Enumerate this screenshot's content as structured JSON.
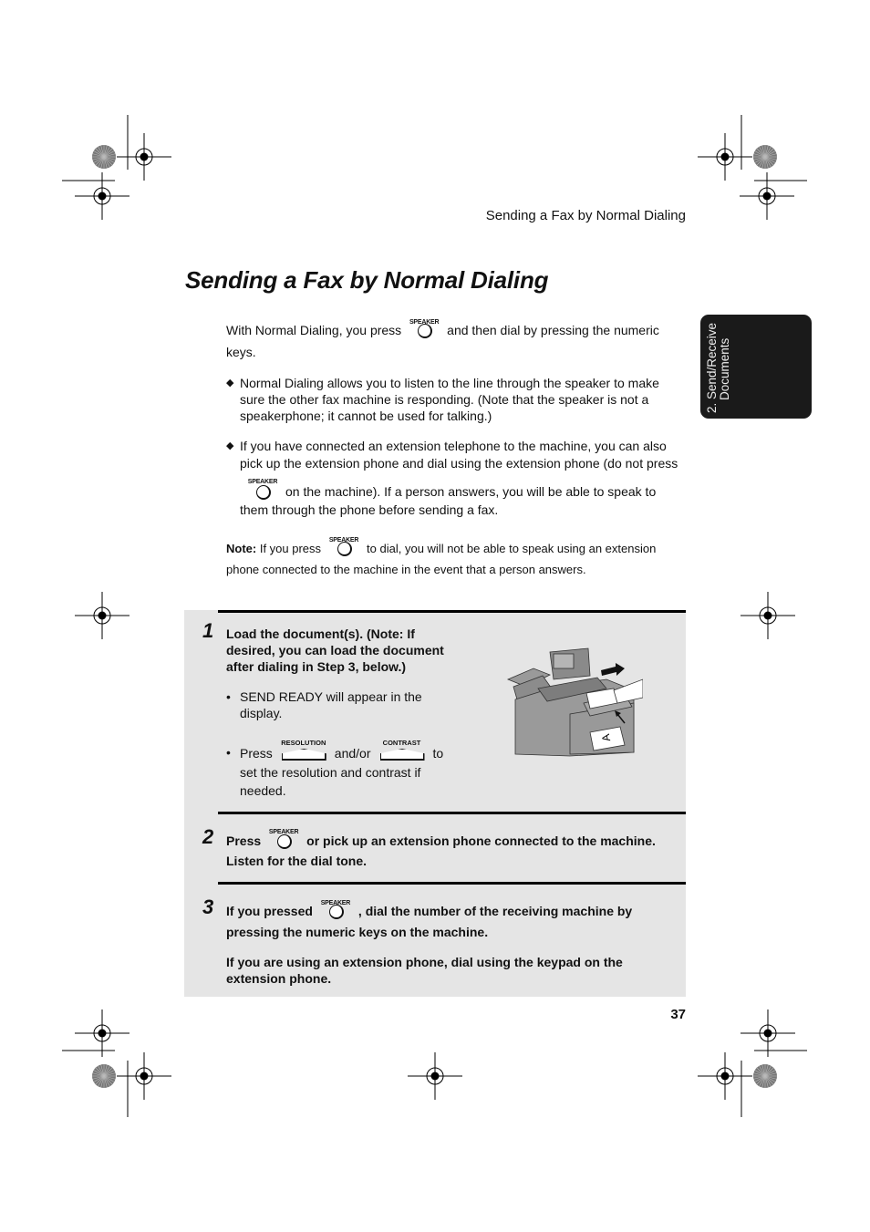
{
  "header": {
    "running_head": "Sending a Fax by Normal Dialing"
  },
  "title": "Sending a Fax by Normal Dialing",
  "side_tab": {
    "line1": "2. Send/Receive",
    "line2": "Documents"
  },
  "keys": {
    "speaker": "SPEAKER",
    "resolution": "RESOLUTION",
    "contrast": "CONTRAST"
  },
  "intro": {
    "before": "With Normal Dialing, you press",
    "after": "and then dial by pressing the numeric keys."
  },
  "bullets": [
    {
      "text": "Normal Dialing allows you to listen to the line through the speaker to make sure the other fax machine is responding. (Note that the speaker is not a speakerphone; it cannot be used for talking.)"
    },
    {
      "before": "If you have connected an extension telephone to the machine, you can also pick up the extension phone and dial using the extension phone (do not press",
      "after": "on the machine). If a person answers, you will be able to speak to them through the phone before sending a fax."
    }
  ],
  "note": {
    "label": "Note:",
    "before": "If you press",
    "after": "to dial, you will not be able to speak using an extension phone connected to the machine in the event that a person answers."
  },
  "steps": [
    {
      "number": "1",
      "text": "Load the document(s). (Note: If desired, you can load the document after dialing in Step 3, below.)",
      "sub": [
        {
          "text": "SEND READY will appear in the display."
        },
        {
          "before": "Press",
          "middle": "and/or",
          "after": "to set the resolution and contrast if needed."
        }
      ]
    },
    {
      "number": "2",
      "before": "Press",
      "after": "or pick up an extension phone connected to the machine. Listen for the dial tone."
    },
    {
      "number": "3",
      "before": "If you pressed",
      "after": ", dial the number of the receiving machine by pressing the numeric keys on the machine.",
      "extra": "If you are using an extension phone, dial using the keypad on the extension phone."
    }
  ],
  "page_number": "37"
}
